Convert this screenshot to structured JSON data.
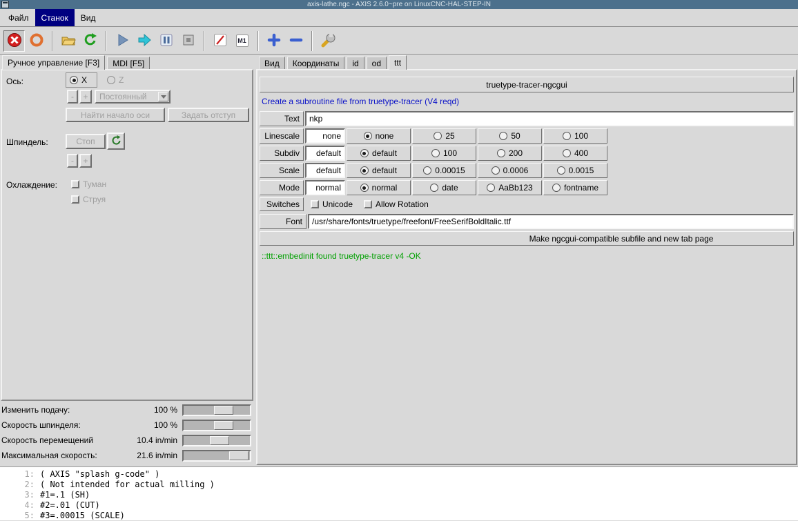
{
  "window": {
    "title": "axis-lathe.ngc - AXIS 2.6.0~pre on LinuxCNC-HAL-STEP-IN"
  },
  "colors": {
    "titlebar": "#4c708c",
    "menu_active": "#000080",
    "link": "#0a12c8",
    "status_ok": "#00a000",
    "estop_red": "#d42020"
  },
  "menu": {
    "file": "Файл",
    "machine": "Станок",
    "view": "Вид"
  },
  "toolbar": {
    "m1_label": "M1"
  },
  "left": {
    "tab_manual": "Ручное управление [F3]",
    "tab_mdi": "MDI [F5]",
    "axis_label": "Ось:",
    "axis_x": "X",
    "axis_z": "Z",
    "jog_minus": "-",
    "jog_plus": "+",
    "jog_mode": "Постоянный",
    "home_button": "Найти начало оси",
    "offset_button": "Задать отступ",
    "spindle_label": "Шпиндель:",
    "spindle_stop": "Стоп",
    "spindle_minus": "-",
    "spindle_plus": "+",
    "coolant_label": "Охлаждение:",
    "mist": "Туман",
    "flood": "Струя",
    "sliders": [
      {
        "label": "Изменить подачу:",
        "value": "100 %"
      },
      {
        "label": "Скорость шпинделя:",
        "value": "100 %"
      },
      {
        "label": "Скорость перемещений",
        "value": "10.4 in/min"
      },
      {
        "label": "Максимальная скорость:",
        "value": "21.6 in/min"
      }
    ]
  },
  "right": {
    "tabs": {
      "preview": "Вид",
      "dro": "Координаты",
      "id": "id",
      "od": "od",
      "ttt": "ttt"
    },
    "ttt": {
      "header": "truetype-tracer-ngcgui",
      "link": "Create a subroutine file from truetype-tracer (V4 reqd)",
      "text_label": "Text",
      "text_value": "nkp",
      "rows": [
        {
          "label": "Linescale",
          "value": "none",
          "options": [
            {
              "label": "none",
              "selected": true
            },
            {
              "label": "25",
              "selected": false
            },
            {
              "label": "50",
              "selected": false
            },
            {
              "label": "100",
              "selected": false
            }
          ]
        },
        {
          "label": "Subdiv",
          "value": "default",
          "options": [
            {
              "label": "default",
              "selected": true
            },
            {
              "label": "100",
              "selected": false
            },
            {
              "label": "200",
              "selected": false
            },
            {
              "label": "400",
              "selected": false
            }
          ]
        },
        {
          "label": "Scale",
          "value": "default",
          "options": [
            {
              "label": "default",
              "selected": true
            },
            {
              "label": "0.00015",
              "selected": false
            },
            {
              "label": "0.0006",
              "selected": false
            },
            {
              "label": "0.0015",
              "selected": false
            }
          ]
        },
        {
          "label": "Mode",
          "value": "normal",
          "options": [
            {
              "label": "normal",
              "selected": true
            },
            {
              "label": "date",
              "selected": false
            },
            {
              "label": "AaBb123",
              "selected": false
            },
            {
              "label": "fontname",
              "selected": false
            }
          ]
        }
      ],
      "switches_label": "Switches",
      "switch_unicode": "Unicode",
      "switch_rotation": "Allow Rotation",
      "font_label": "Font",
      "font_value": "/usr/share/fonts/truetype/freefont/FreeSerifBoldItalic.ttf",
      "make_button": "Make ngcgui-compatible subfile and new tab page",
      "status": "::ttt::embedinit found truetype-tracer v4 -OK"
    }
  },
  "gcode": {
    "lines": [
      {
        "num": "1:",
        "text": "( AXIS \"splash g-code\" )"
      },
      {
        "num": "2:",
        "text": "( Not intended for actual milling )"
      },
      {
        "num": "3:",
        "text": "#1=.1 (SH)"
      },
      {
        "num": "4:",
        "text": "#2=.01 (CUT)"
      },
      {
        "num": "5:",
        "text": "#3=.00015 (SCALE)"
      }
    ]
  }
}
